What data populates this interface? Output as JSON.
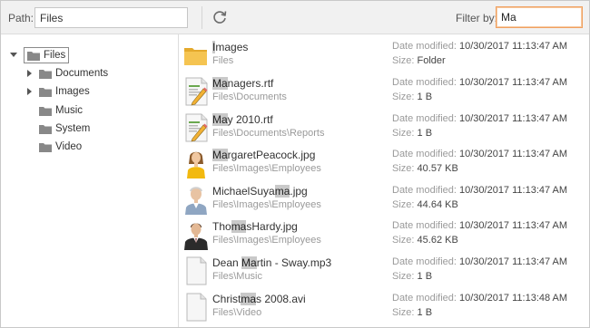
{
  "toolbar": {
    "path_label": "Path:",
    "path_value": "Files",
    "refresh_icon": "refresh-icon",
    "filter_label": "Filter by:",
    "filter_value": "Ma"
  },
  "tree": {
    "root": "Files",
    "children": [
      {
        "label": "Documents",
        "expandable": true
      },
      {
        "label": "Images",
        "expandable": true
      },
      {
        "label": "Music",
        "expandable": false
      },
      {
        "label": "System",
        "expandable": false
      },
      {
        "label": "Video",
        "expandable": false
      }
    ]
  },
  "files": [
    {
      "name_parts": [
        "",
        "I",
        "mages"
      ],
      "path": "Files",
      "date_label": "Date modified:",
      "date": "10/30/2017 11:13:47 AM",
      "size_label": "Size:",
      "size": "Folder",
      "icon": "folder"
    },
    {
      "name_parts": [
        "",
        "Ma",
        "nagers.rtf"
      ],
      "path": "Files\\Documents",
      "date_label": "Date modified:",
      "date": "10/30/2017 11:13:47 AM",
      "size_label": "Size:",
      "size": "1 B",
      "icon": "document"
    },
    {
      "name_parts": [
        "",
        "Ma",
        "y 2010.rtf"
      ],
      "path": "Files\\Documents\\Reports",
      "date_label": "Date modified:",
      "date": "10/30/2017 11:13:47 AM",
      "size_label": "Size:",
      "size": "1 B",
      "icon": "document"
    },
    {
      "name_parts": [
        "",
        "Ma",
        "rgaretPeacock.jpg"
      ],
      "path": "Files\\Images\\Employees",
      "date_label": "Date modified:",
      "date": "10/30/2017 11:13:47 AM",
      "size_label": "Size:",
      "size": "40.57 KB",
      "icon": "photo-woman-yellow"
    },
    {
      "name_parts": [
        "MichaelSuya",
        "ma",
        ".jpg"
      ],
      "path": "Files\\Images\\Employees",
      "date_label": "Date modified:",
      "date": "10/30/2017 11:13:47 AM",
      "size_label": "Size:",
      "size": "44.64 KB",
      "icon": "photo-man-elderly"
    },
    {
      "name_parts": [
        "Tho",
        "ma",
        "sHardy.jpg"
      ],
      "path": "Files\\Images\\Employees",
      "date_label": "Date modified:",
      "date": "10/30/2017 11:13:47 AM",
      "size_label": "Size:",
      "size": "45.62 KB",
      "icon": "photo-man-suit"
    },
    {
      "name_parts": [
        "Dean ",
        "Ma",
        "rtin - Sway.mp3"
      ],
      "path": "Files\\Music",
      "date_label": "Date modified:",
      "date": "10/30/2017 11:13:47 AM",
      "size_label": "Size:",
      "size": "1 B",
      "icon": "blank-file"
    },
    {
      "name_parts": [
        "Christ",
        "ma",
        "s 2008.avi"
      ],
      "path": "Files\\Video",
      "date_label": "Date modified:",
      "date": "10/30/2017 11:13:48 AM",
      "size_label": "Size:",
      "size": "1 B",
      "icon": "blank-file"
    }
  ],
  "colors": {
    "toolbar_bg": "#f1f1f1",
    "filter_border": "#f0a060",
    "highlight": "#c9c9c9",
    "folder_yellow": "#f5c451"
  }
}
